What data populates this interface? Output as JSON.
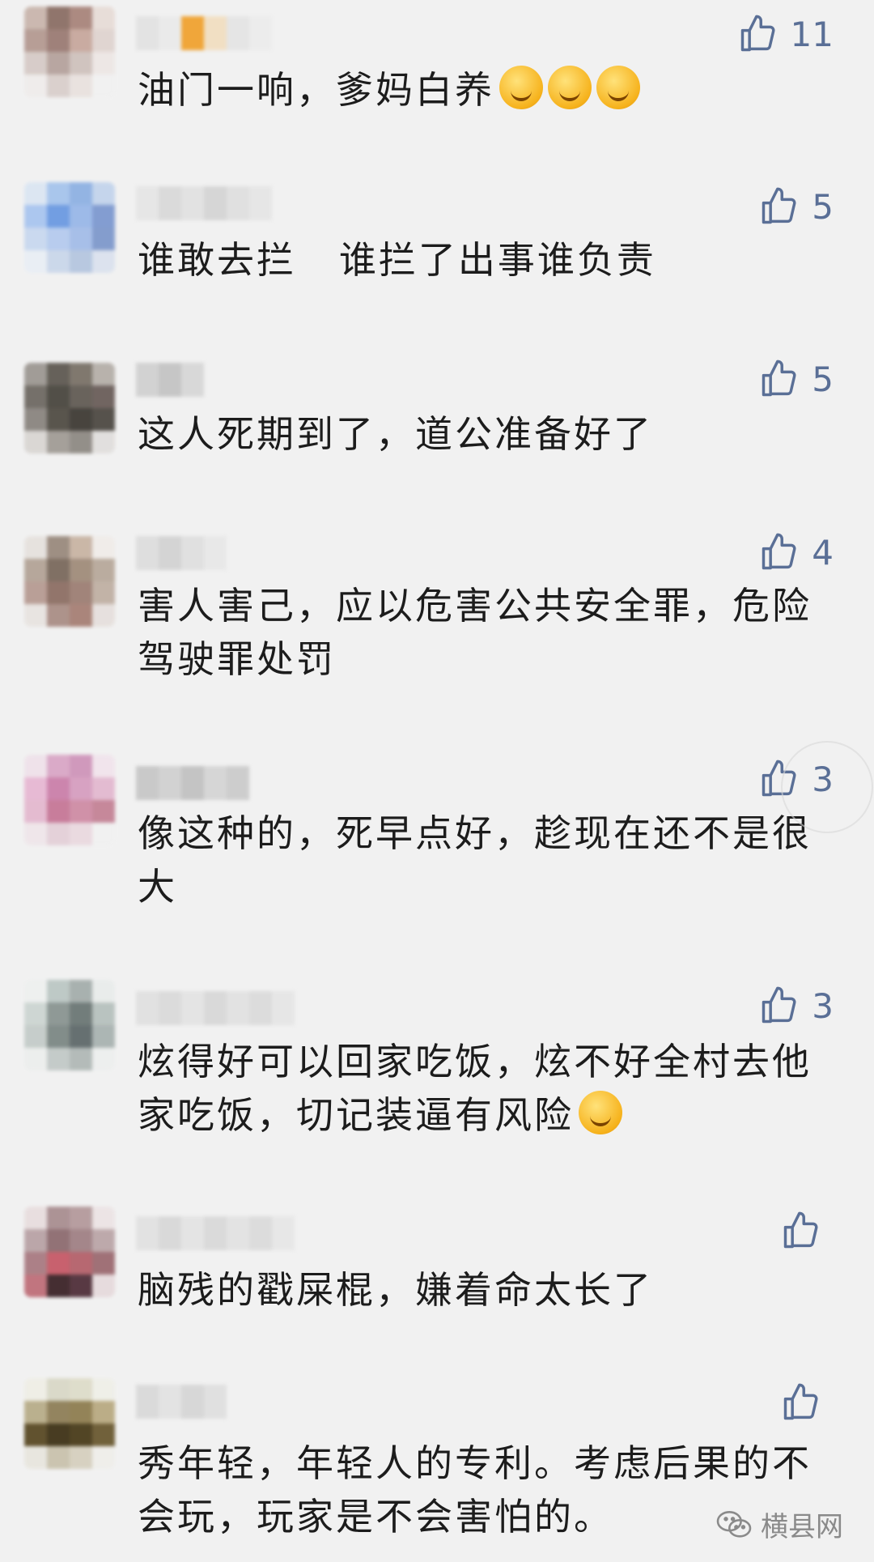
{
  "comments": [
    {
      "likes": "11",
      "text": "油门一响，爹妈白养",
      "emoji_count": 3
    },
    {
      "likes": "5",
      "text": "谁敢去拦   谁拦了出事谁负责"
    },
    {
      "likes": "5",
      "text": "这人死期到了，道公准备好了"
    },
    {
      "likes": "4",
      "text": "害人害己，应以危害公共安全罪，危险驾驶罪处罚"
    },
    {
      "likes": "3",
      "text": "像这种的，死早点好，趁现在还不是很大"
    },
    {
      "likes": "3",
      "text": "炫得好可以回家吃饭，炫不好全村去他家吃饭，切记装逼有风险"
    },
    {
      "likes": "",
      "text": "脑残的戳屎棍，嫌着命太长了"
    },
    {
      "likes": "",
      "text": "秀年轻，年轻人的专利。考虑后果的不会玩，玩家是不会害怕的。"
    }
  ],
  "watermark": {
    "label": "横县网"
  },
  "icons": {
    "like": "thumbs-up-icon",
    "watermark": "wechat-icon",
    "emoji": "grinning-face-icon"
  },
  "colors": {
    "background": "#f1f1f1",
    "like": "#5a6f96",
    "text": "#1c1c1c"
  }
}
